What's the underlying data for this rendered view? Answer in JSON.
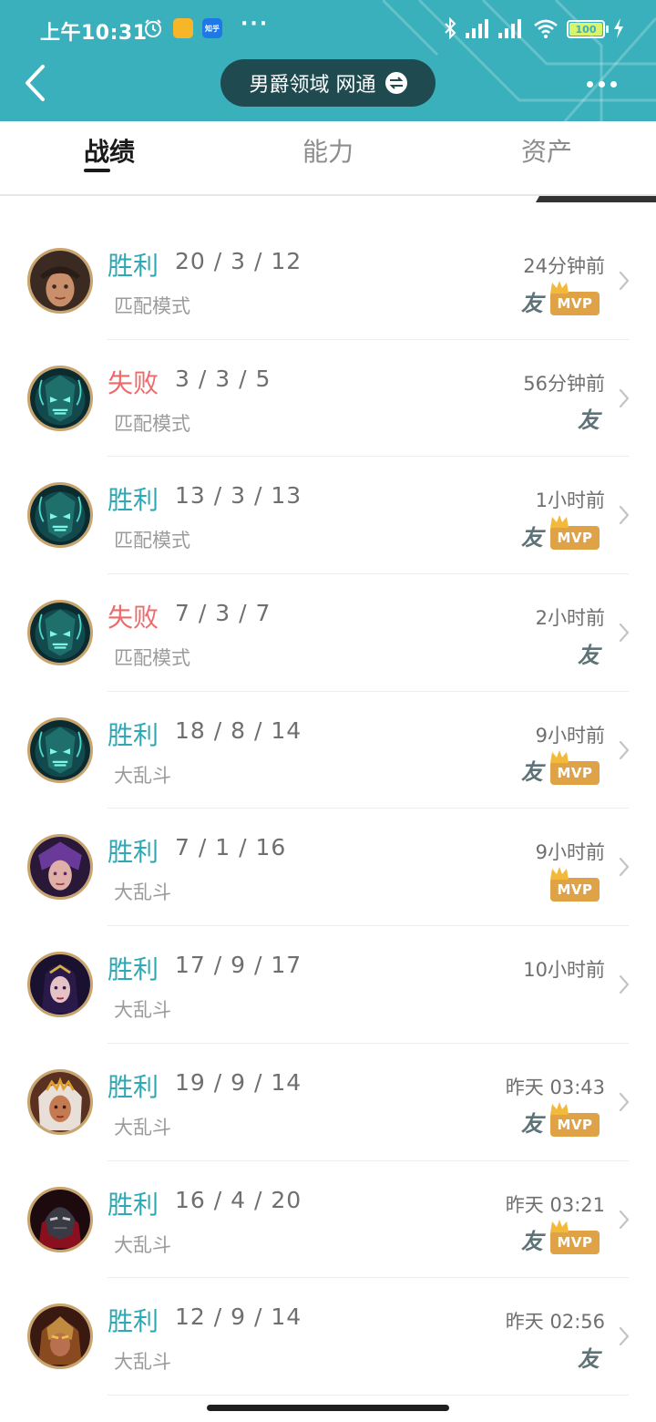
{
  "status_bar": {
    "time": "上午10:31",
    "zhihu_label": "知乎",
    "battery": "100"
  },
  "header": {
    "server_name": "男爵领域 网通",
    "icons": [
      "back-icon",
      "swap-icon",
      "more-icon"
    ]
  },
  "tabs": [
    {
      "label": "战绩",
      "active": true
    },
    {
      "label": "能力",
      "active": false
    },
    {
      "label": "资产",
      "active": false
    }
  ],
  "matches": [
    {
      "result": "胜利",
      "outcome": "win",
      "kda": "20 / 3 / 12",
      "mode": "匹配模式",
      "time": "24分钟前",
      "friend": "友",
      "mvp": "MVP",
      "champion_art": "cowboy"
    },
    {
      "result": "失败",
      "outcome": "loss",
      "kda": "3 / 3 / 5",
      "mode": "匹配模式",
      "time": "56分钟前",
      "friend": "友",
      "mvp": "",
      "champion_art": "thresh"
    },
    {
      "result": "胜利",
      "outcome": "win",
      "kda": "13 / 3 / 13",
      "mode": "匹配模式",
      "time": "1小时前",
      "friend": "友",
      "mvp": "MVP",
      "champion_art": "thresh"
    },
    {
      "result": "失败",
      "outcome": "loss",
      "kda": "7 / 3 / 7",
      "mode": "匹配模式",
      "time": "2小时前",
      "friend": "友",
      "mvp": "",
      "champion_art": "thresh"
    },
    {
      "result": "胜利",
      "outcome": "win",
      "kda": "18 / 8 / 14",
      "mode": "大乱斗",
      "time": "9小时前",
      "friend": "友",
      "mvp": "MVP",
      "champion_art": "thresh"
    },
    {
      "result": "胜利",
      "outcome": "win",
      "kda": "7 / 1 / 16",
      "mode": "大乱斗",
      "time": "9小时前",
      "friend": "",
      "mvp": "MVP",
      "champion_art": "purple"
    },
    {
      "result": "胜利",
      "outcome": "win",
      "kda": "17 / 9 / 17",
      "mode": "大乱斗",
      "time": "10小时前",
      "friend": "",
      "mvp": "",
      "champion_art": "sorceress"
    },
    {
      "result": "胜利",
      "outcome": "win",
      "kda": "19 / 9 / 14",
      "mode": "大乱斗",
      "time": "昨天 03:43",
      "friend": "友",
      "mvp": "MVP",
      "champion_art": "queen"
    },
    {
      "result": "胜利",
      "outcome": "win",
      "kda": "16 / 4 / 20",
      "mode": "大乱斗",
      "time": "昨天 03:21",
      "friend": "友",
      "mvp": "MVP",
      "champion_art": "masked"
    },
    {
      "result": "胜利",
      "outcome": "win",
      "kda": "12 / 9 / 14",
      "mode": "大乱斗",
      "time": "昨天 02:56",
      "friend": "友",
      "mvp": "",
      "champion_art": "warrior"
    }
  ],
  "colors": {
    "header_bg": "#3ab0bc",
    "win": "#2fa8b5",
    "loss": "#ee6a6a",
    "mvp": "#dfa247",
    "avatar_border": "#c9a46d"
  }
}
